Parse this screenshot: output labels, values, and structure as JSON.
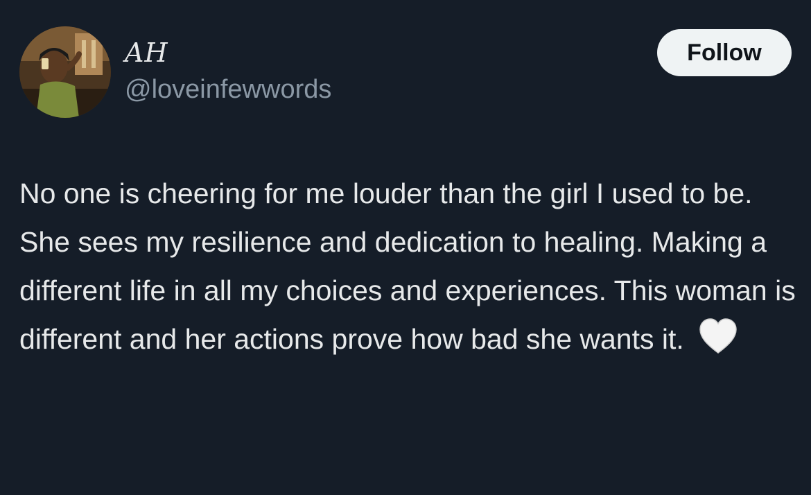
{
  "author": {
    "display_name": "AH",
    "handle": "@loveinfewwords"
  },
  "follow_button": {
    "label": "Follow"
  },
  "tweet": {
    "text": "No one is cheering for me louder than the girl I used to be. She sees my resilience and dedication to healing. Making a different life in all my choices and experiences. This woman is different and her actions prove how bad she wants it.",
    "emoji_icon": "white-heart-icon"
  },
  "colors": {
    "background": "#151d28",
    "text_primary": "#e7e9ea",
    "text_secondary": "#8b98a5",
    "button_bg": "#eff3f4",
    "button_text": "#0f1419"
  }
}
